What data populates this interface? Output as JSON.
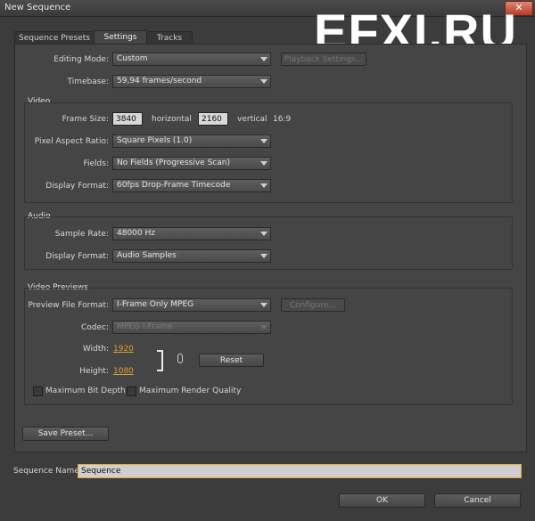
{
  "window": {
    "title": "New Sequence",
    "close_glyph": "✕"
  },
  "watermark": "EFXI.RU",
  "tabs": [
    {
      "label": "Sequence Presets"
    },
    {
      "label": "Settings"
    },
    {
      "label": "Tracks"
    }
  ],
  "general": {
    "editing_mode_label": "Editing Mode:",
    "editing_mode_value": "Custom",
    "playback_settings_label": "Playback Settings...",
    "timebase_label": "Timebase:",
    "timebase_value": "59,94 frames/second"
  },
  "video": {
    "title": "Video",
    "frame_size_label": "Frame Size:",
    "frame_width": "3840",
    "horizontal_label": "horizontal",
    "frame_height": "2160",
    "vertical_label": "vertical",
    "aspect": "16:9",
    "par_label": "Pixel Aspect Ratio:",
    "par_value": "Square Pixels (1.0)",
    "fields_label": "Fields:",
    "fields_value": "No Fields (Progressive Scan)",
    "display_format_label": "Display Format:",
    "display_format_value": "60fps Drop-Frame Timecode"
  },
  "audio": {
    "title": "Audio",
    "sample_rate_label": "Sample Rate:",
    "sample_rate_value": "48000 Hz",
    "display_format_label": "Display Format:",
    "display_format_value": "Audio Samples"
  },
  "previews": {
    "title": "Video Previews",
    "file_format_label": "Preview File Format:",
    "file_format_value": "I-Frame Only MPEG",
    "configure_label": "Configure...",
    "codec_label": "Codec:",
    "codec_value": "MPEG I-Frame",
    "width_label": "Width:",
    "width_value": "1920",
    "height_label": "Height:",
    "height_value": "1080",
    "reset_label": "Reset",
    "max_bit_depth_label": "Maximum Bit Depth",
    "max_render_quality_label": "Maximum Render Quality"
  },
  "save_preset_label": "Save Preset...",
  "sequence_name_label": "Sequence Name:",
  "sequence_name_value": "Sequence",
  "ok_label": "OK",
  "cancel_label": "Cancel"
}
